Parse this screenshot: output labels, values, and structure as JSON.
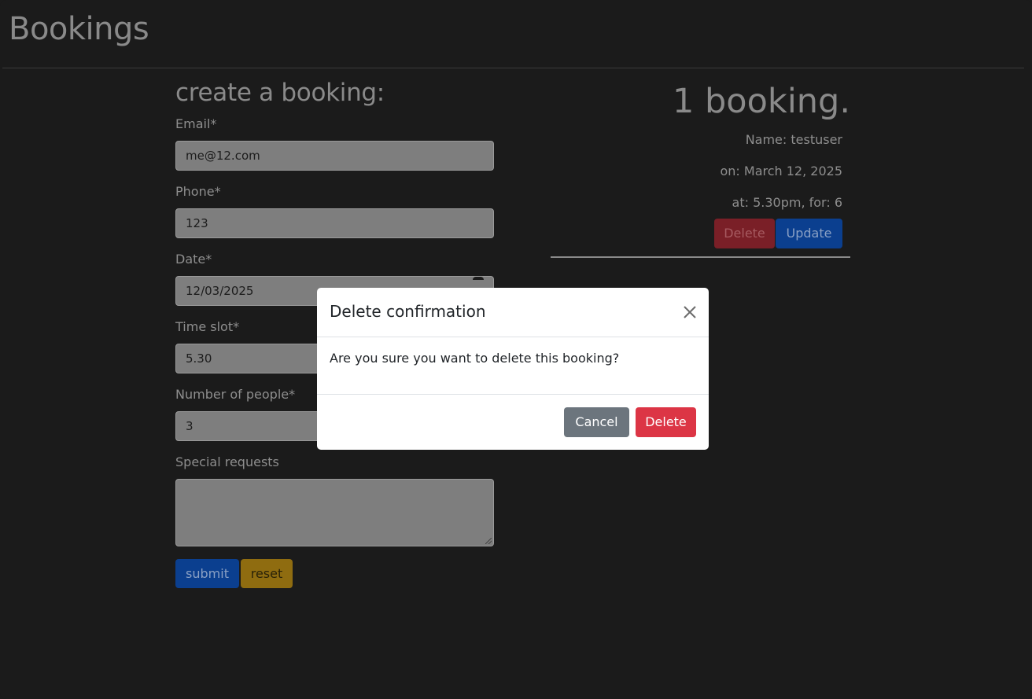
{
  "header": {
    "title": "Bookings"
  },
  "form": {
    "heading": "create a booking:",
    "email": {
      "label": "Email*",
      "value": "me@12.com"
    },
    "phone": {
      "label": "Phone*",
      "value": "123"
    },
    "date": {
      "label": "Date*",
      "value": "12/03/2025"
    },
    "time_slot": {
      "label": "Time slot*",
      "value": "5.30"
    },
    "people": {
      "label": "Number of people*",
      "value": "3"
    },
    "special": {
      "label": "Special requests",
      "value": ""
    },
    "submit_label": "submit",
    "reset_label": "reset"
  },
  "bookings": {
    "count_heading": "1 booking.",
    "items": [
      {
        "name_line": "Name: testuser",
        "date_line": "on: March 12, 2025",
        "time_line": "at: 5.30pm, for: 6",
        "delete_label": "Delete",
        "update_label": "Update"
      }
    ]
  },
  "modal": {
    "title": "Delete confirmation",
    "message": "Are you sure you want to delete this booking?",
    "cancel_label": "Cancel",
    "confirm_label": "Delete"
  },
  "colors": {
    "background": "#1b1b1b",
    "primary": "#0d6efd",
    "danger": "#dc3545",
    "secondary": "#6c757d",
    "warning": "#ffc107"
  }
}
